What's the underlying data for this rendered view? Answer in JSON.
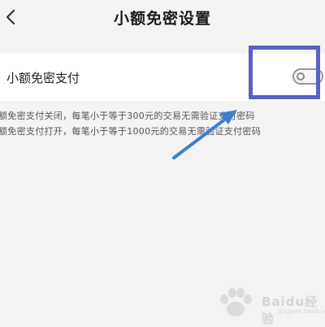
{
  "header": {
    "back_icon": "chevron-left-icon",
    "title": "小额免密设置"
  },
  "setting": {
    "label": "小额免密支付",
    "toggle_state": "off"
  },
  "description": {
    "line1": "额免密支付关闭，每笔小于等于300元的交易无需验证支付密码",
    "line2": "额免密支付打开，每笔小于等于1000元的交易无需验证支付密码"
  },
  "colors": {
    "highlight_box": "#5b5fc8",
    "arrow": "#3f7fd0"
  },
  "watermark": {
    "brand": "Baidu经验",
    "sub": "jingyan.baidu.com"
  }
}
